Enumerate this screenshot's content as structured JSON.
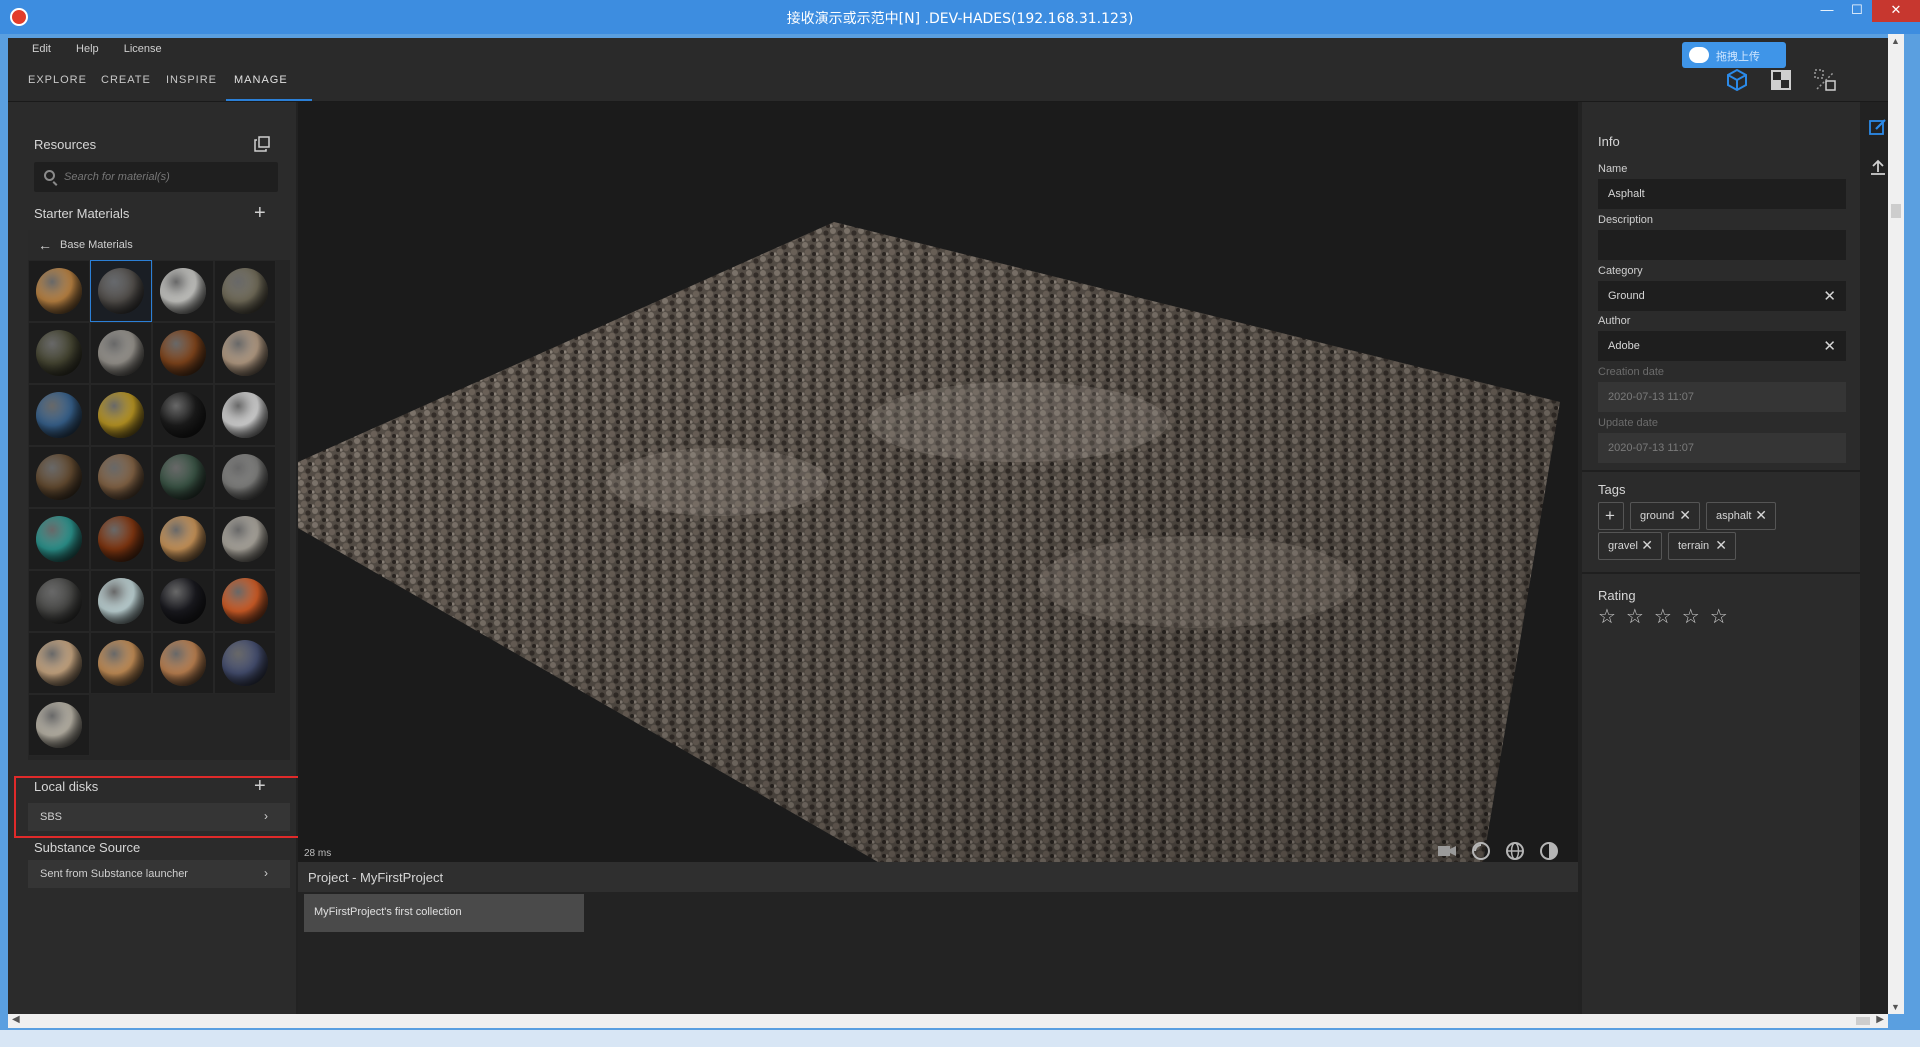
{
  "window": {
    "title": "接收演示或示范中[N] .DEV-HADES(192.168.31.123)",
    "min": "—",
    "max": "☐",
    "close": "✕"
  },
  "menu": [
    "Edit",
    "Help",
    "License"
  ],
  "tabs": [
    {
      "label": "EXPLORE"
    },
    {
      "label": "CREATE"
    },
    {
      "label": "INSPIRE"
    },
    {
      "label": "MANAGE",
      "active": true
    }
  ],
  "upload_pill": {
    "label": "拖拽上传"
  },
  "left": {
    "resources_title": "Resources",
    "search_placeholder": "Search for material(s)",
    "starter_title": "Starter Materials",
    "breadcrumb": "Base Materials",
    "materials": [
      "#c98d48",
      "#5a5652",
      "#d8d8d4",
      "#7a7460",
      "#4b4b36",
      "#a39f98",
      "#8a4a1e",
      "#c2a88e",
      "#3b6896",
      "#c7a126",
      "#1e1e1e",
      "#e6e6e6",
      "#6a5034",
      "#8c6a4a",
      "#3e5a4a",
      "#8a8a88",
      "#2f9f98",
      "#8a3a12",
      "#d9a060",
      "#b9b4aa",
      "#4e4e4c",
      "#cfe6e8",
      "#1c1c22",
      "#e0642a",
      "#d8b48c",
      "#d49a5e",
      "#cc8c58",
      "#4a5478",
      "#c8c2b4"
    ],
    "local_title": "Local disks",
    "local_items": [
      {
        "label": "SBS"
      }
    ],
    "source_title": "Substance Source",
    "source_items": [
      {
        "label": "Sent from Substance launcher"
      }
    ]
  },
  "viewport": {
    "frame_time": "28 ms"
  },
  "project": {
    "title": "Project - MyFirstProject",
    "collection": "MyFirstProject's first collection"
  },
  "info": {
    "title": "Info",
    "name_label": "Name",
    "name_value": "Asphalt",
    "description_label": "Description",
    "description_value": "",
    "category_label": "Category",
    "category_value": "Ground",
    "author_label": "Author",
    "author_value": "Adobe",
    "creation_label": "Creation date",
    "creation_value": "2020-07-13 11:07",
    "update_label": "Update date",
    "update_value": "2020-07-13 11:07"
  },
  "tags": {
    "title": "Tags",
    "add": "+",
    "items": [
      "ground",
      "asphalt",
      "gravel",
      "terrain"
    ]
  },
  "rating": {
    "title": "Rating",
    "value": 0,
    "max": 5,
    "stars": "☆☆☆☆☆"
  },
  "colors": {
    "accent": "#2b7fd6",
    "highlight_box": "#e02a2a",
    "titlebar": "#3d8de0"
  }
}
